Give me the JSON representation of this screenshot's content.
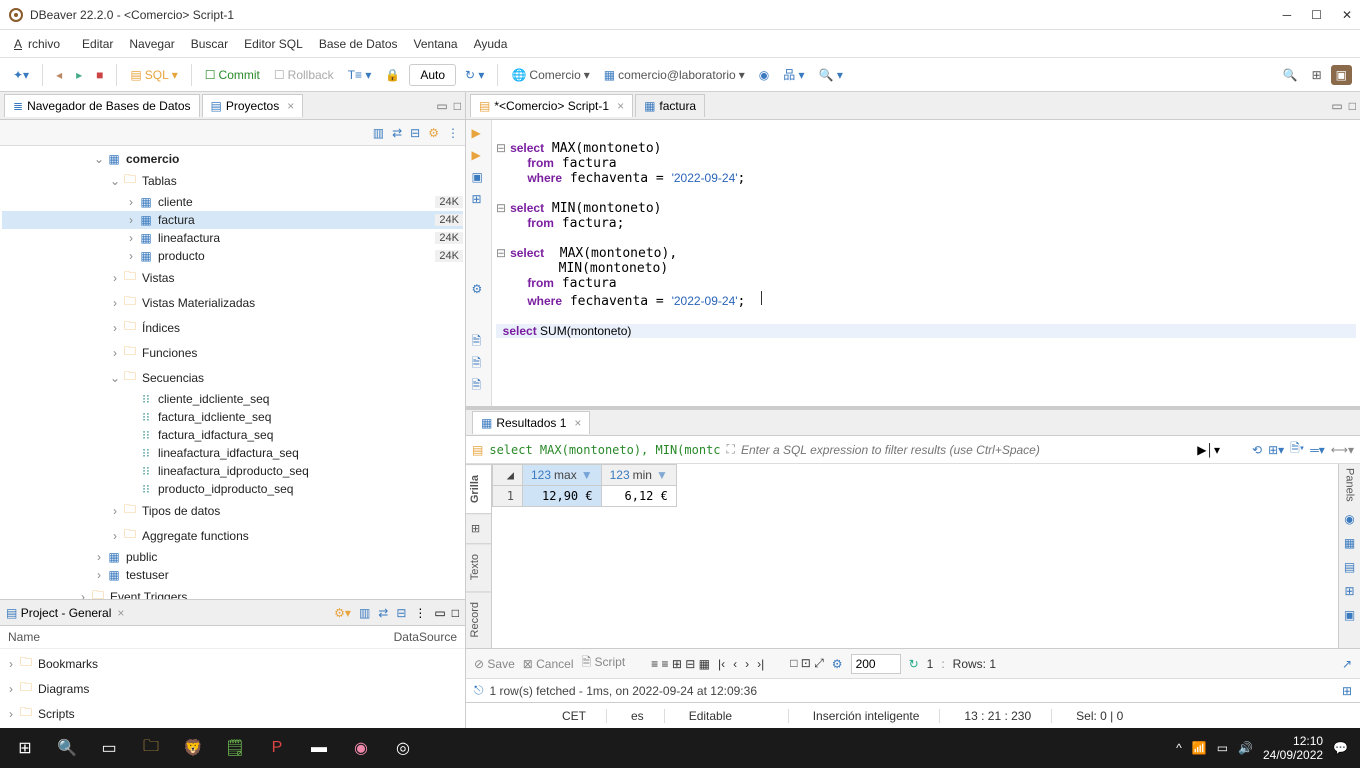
{
  "window": {
    "title": "DBeaver 22.2.0 - <Comercio> Script-1"
  },
  "menu": [
    "Archivo",
    "Editar",
    "Navegar",
    "Buscar",
    "Editor SQL",
    "Base de Datos",
    "Ventana",
    "Ayuda"
  ],
  "toolbar": {
    "sql": "SQL",
    "commit": "Commit",
    "rollback": "Rollback",
    "auto": "Auto",
    "conn_db": "Comercio",
    "conn_ds": "comercio@laboratorio"
  },
  "left_tabs": {
    "nav": "Navegador de Bases de Datos",
    "proj": "Proyectos"
  },
  "tree": {
    "root": "comercio",
    "tablas": "Tablas",
    "tables": [
      {
        "name": "cliente",
        "count": "24K"
      },
      {
        "name": "factura",
        "count": "24K"
      },
      {
        "name": "lineafactura",
        "count": "24K"
      },
      {
        "name": "producto",
        "count": "24K"
      }
    ],
    "vistas": "Vistas",
    "vistasm": "Vistas Materializadas",
    "indices": "Índices",
    "funciones": "Funciones",
    "secuencias": "Secuencias",
    "seqs": [
      "cliente_idcliente_seq",
      "factura_idcliente_seq",
      "factura_idfactura_seq",
      "lineafactura_idfactura_seq",
      "lineafactura_idproducto_seq",
      "producto_idproducto_seq"
    ],
    "tipos": "Tipos de datos",
    "aggs": "Aggregate functions",
    "public": "public",
    "testuser": "testuser",
    "triggers": "Event Triggers"
  },
  "project": {
    "title": "Project - General",
    "col1": "Name",
    "col2": "DataSource",
    "items": [
      "Bookmarks",
      "Diagrams",
      "Scripts"
    ]
  },
  "editor_tabs": {
    "script": "*<Comercio> Script-1",
    "factura": "factura"
  },
  "sql": {
    "q1_l1": "select MAX(montoneto)",
    "q1_l2": "    from factura",
    "q1_l3": "    where fechaventa = '2022-09-24';",
    "q2_l1": "select MIN(montoneto)",
    "q2_l2": "    from factura;",
    "q3_l1": "select  MAX(montoneto),",
    "q3_l2": "        MIN(montoneto)",
    "q3_l3": "    from factura",
    "q3_l4": "    where fechaventa = '2022-09-24';",
    "q4_l1": "select SUM(montoneto)"
  },
  "results": {
    "tab": "Resultados 1",
    "filter_sql": "select MAX(montoneto), MIN(montc",
    "filter_placeholder": "Enter a SQL expression to filter results (use Ctrl+Space)",
    "side_tabs": [
      "Grilla",
      "⊞",
      "Texto",
      "Record"
    ],
    "cols": [
      "max",
      "min"
    ],
    "row": [
      "12,90 €",
      "6,12 €"
    ],
    "save": "Save",
    "cancel": "Cancel",
    "script": "Script",
    "pagesize": "200",
    "rows_label": "Rows:",
    "rows_val": "1",
    "page": "1",
    "status": "1 row(s) fetched - 1ms, on 2022-09-24 at 12:09:36"
  },
  "statusbar": {
    "tz": "CET",
    "lang": "es",
    "mode": "Editable",
    "ins": "Inserción inteligente",
    "pos": "13 : 21 : 230",
    "sel": "Sel: 0 | 0"
  },
  "panels": "Panels",
  "taskbar": {
    "time": "12:10",
    "date": "24/09/2022"
  }
}
